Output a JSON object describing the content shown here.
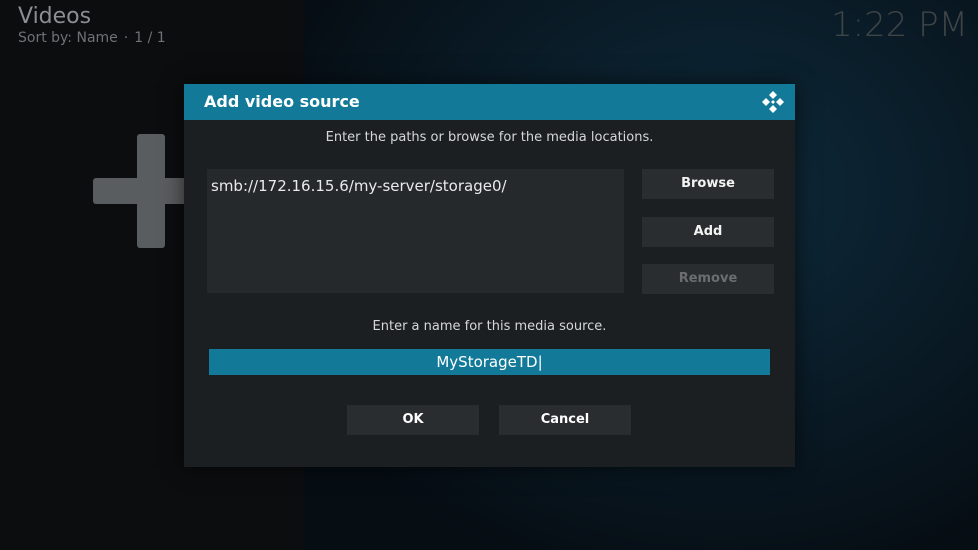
{
  "header": {
    "title": "Videos",
    "sort_label": "Sort by: Name",
    "separator": "·",
    "page_count": "1 / 1",
    "clock": "1:22 PM"
  },
  "dialog": {
    "title": "Add video source",
    "paths_instruction": "Enter the paths or browse for the media locations.",
    "paths": [
      "smb://172.16.15.6/my-server/storage0/"
    ],
    "browse_label": "Browse",
    "add_label": "Add",
    "remove_label": "Remove",
    "name_instruction": "Enter a name for this media source.",
    "name_value": "MyStorageTD|",
    "ok_label": "OK",
    "cancel_label": "Cancel"
  },
  "colors": {
    "accent": "#127a98",
    "dialog_bg": "#1c1f21",
    "button_bg": "#2a2d2f"
  },
  "icons": {
    "add_source": "plus-icon",
    "logo": "kodi-logo-icon"
  }
}
